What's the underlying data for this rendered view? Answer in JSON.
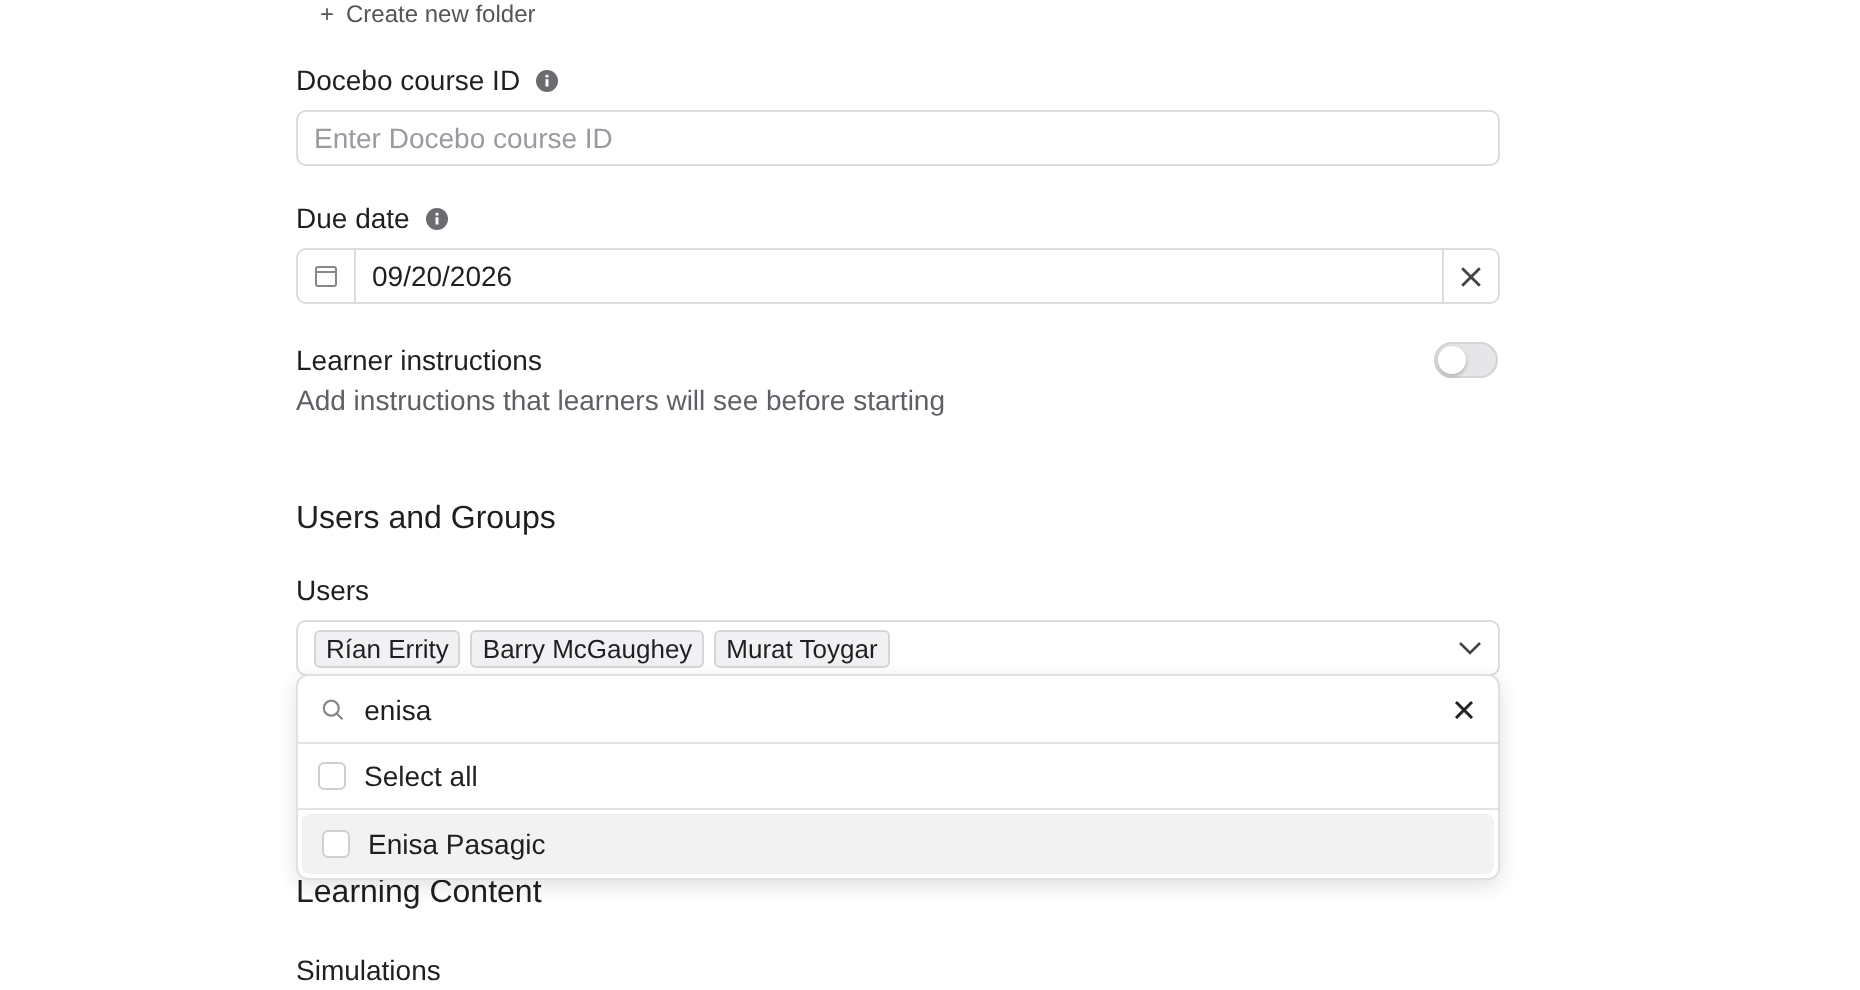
{
  "create_folder_link": {
    "icon": "+",
    "label": "Create new folder"
  },
  "course_id": {
    "label": "Docebo course ID",
    "placeholder": "Enter Docebo course ID"
  },
  "due_date": {
    "label": "Due date",
    "value": "09/20/2026"
  },
  "learner_instructions": {
    "label": "Learner instructions",
    "description": "Add instructions that learners will see before starting",
    "on": false
  },
  "users_and_groups": {
    "heading": "Users and Groups",
    "users_label": "Users",
    "selected_users": [
      "Rían Errity",
      "Barry McGaughey",
      "Murat Toygar"
    ],
    "dropdown": {
      "search_value": "enisa",
      "options": [
        {
          "label": "Select all",
          "checked": false,
          "highlighted": false
        },
        {
          "label": "Enisa Pasagic",
          "checked": false,
          "highlighted": true
        }
      ]
    }
  },
  "learning_content": {
    "heading": "Learning Content",
    "simulations_label": "Simulations"
  }
}
